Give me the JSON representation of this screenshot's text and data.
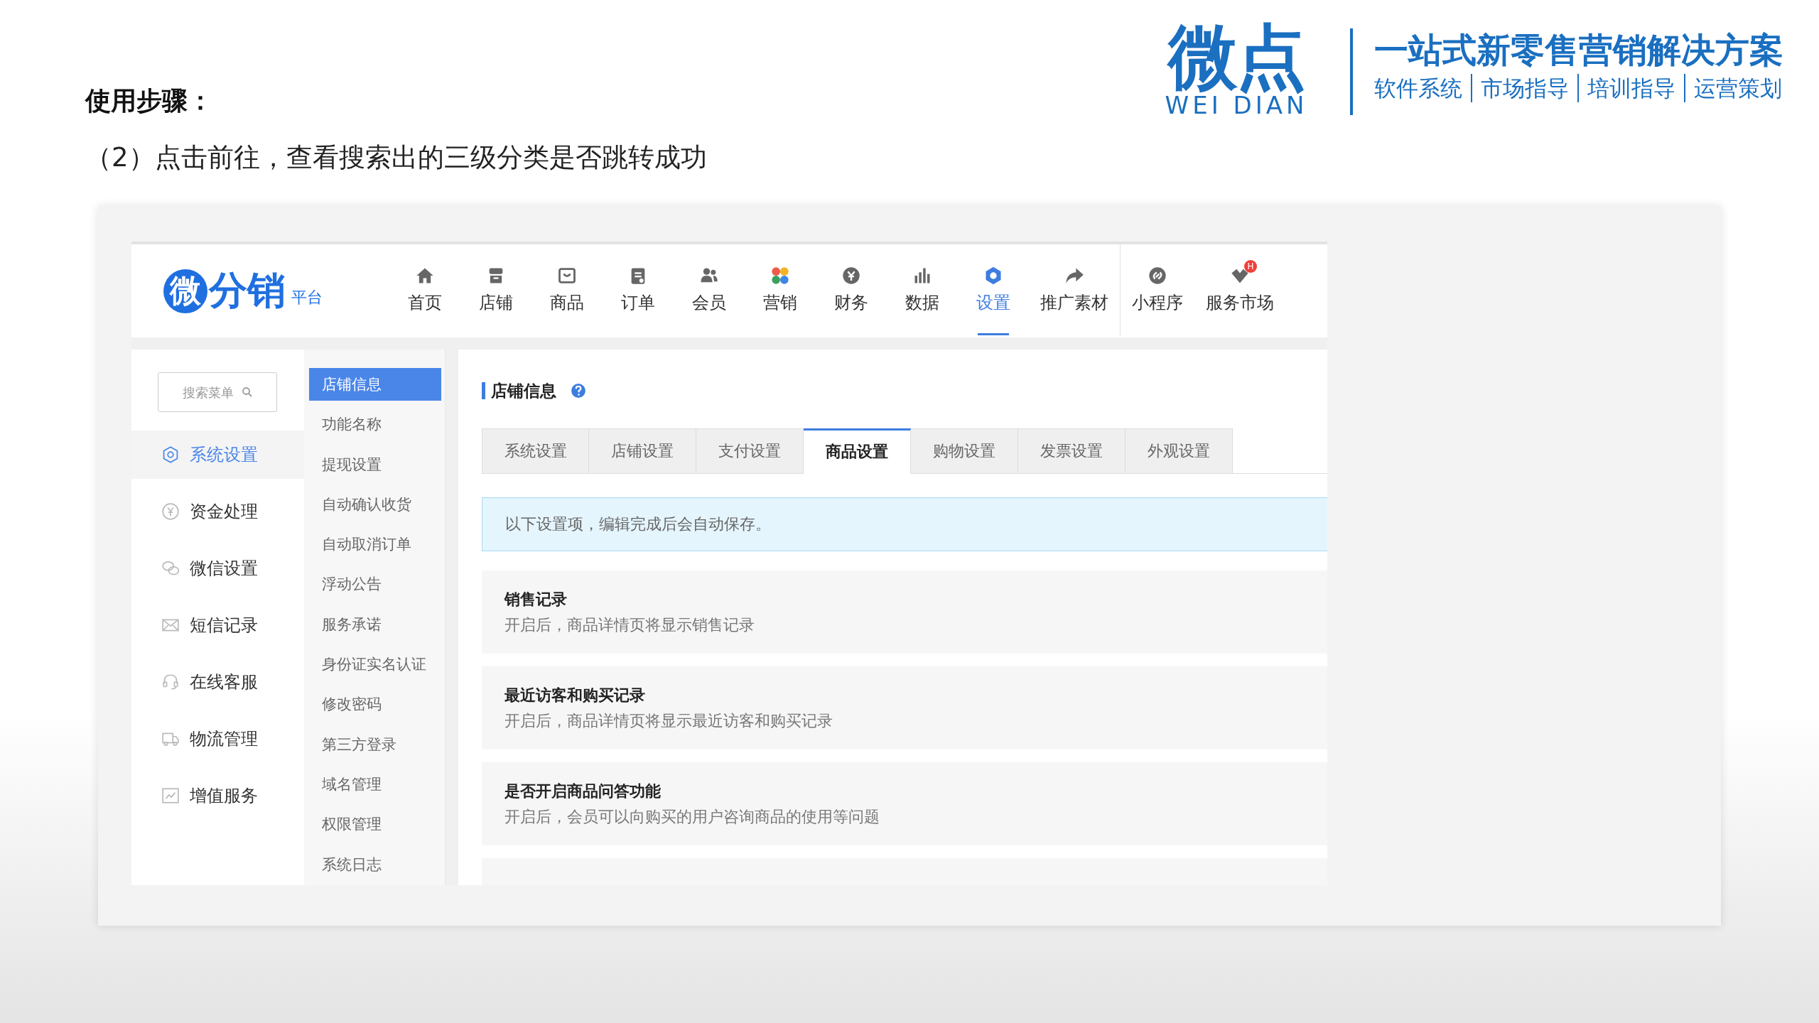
{
  "heading": "使用步骤：",
  "step": "（2）点击前往，查看搜索出的三级分类是否跳转成功",
  "brand": {
    "name": "微点",
    "latin": "WEI DIAN",
    "slogan": "一站式新零售营销解决方案",
    "services": [
      "软件系统",
      "市场指导",
      "培训指导",
      "运营策划"
    ]
  },
  "app": {
    "logo": {
      "mark": "微",
      "name": "分销",
      "suffix": "平台"
    },
    "nav": [
      {
        "label": "首页",
        "kind": "home",
        "selected": false,
        "separated": false
      },
      {
        "label": "店铺",
        "kind": "shop",
        "selected": false,
        "separated": false
      },
      {
        "label": "商品",
        "kind": "goods",
        "selected": false,
        "separated": false
      },
      {
        "label": "订单",
        "kind": "order",
        "selected": false,
        "separated": false
      },
      {
        "label": "会员",
        "kind": "member",
        "selected": false,
        "separated": false
      },
      {
        "label": "营销",
        "kind": "marketing",
        "selected": false,
        "separated": false
      },
      {
        "label": "财务",
        "kind": "finance",
        "selected": false,
        "separated": false
      },
      {
        "label": "数据",
        "kind": "data",
        "selected": false,
        "separated": false
      },
      {
        "label": "设置",
        "kind": "settings",
        "selected": true,
        "separated": false
      },
      {
        "label": "推广素材",
        "kind": "share",
        "selected": false,
        "separated": false
      },
      {
        "label": "小程序",
        "kind": "link",
        "selected": false,
        "separated": true
      },
      {
        "label": "服务市场",
        "kind": "market",
        "selected": false,
        "separated": false,
        "badge": "H"
      }
    ],
    "search": {
      "placeholder": "搜索菜单"
    },
    "sidebar": [
      {
        "label": "系统设置",
        "kind": "gear",
        "selected": true
      },
      {
        "label": "资金处理",
        "kind": "yuan",
        "selected": false
      },
      {
        "label": "微信设置",
        "kind": "chat",
        "selected": false
      },
      {
        "label": "短信记录",
        "kind": "mail",
        "selected": false
      },
      {
        "label": "在线客服",
        "kind": "headset",
        "selected": false
      },
      {
        "label": "物流管理",
        "kind": "truck",
        "selected": false
      },
      {
        "label": "增值服务",
        "kind": "chart",
        "selected": false
      }
    ],
    "submenu": [
      {
        "label": "店铺信息",
        "selected": true
      },
      {
        "label": "功能名称",
        "selected": false
      },
      {
        "label": "提现设置",
        "selected": false
      },
      {
        "label": "自动确认收货",
        "selected": false
      },
      {
        "label": "自动取消订单",
        "selected": false
      },
      {
        "label": "浮动公告",
        "selected": false
      },
      {
        "label": "服务承诺",
        "selected": false
      },
      {
        "label": "身份证实名认证",
        "selected": false
      },
      {
        "label": "修改密码",
        "selected": false
      },
      {
        "label": "第三方登录",
        "selected": false
      },
      {
        "label": "域名管理",
        "selected": false
      },
      {
        "label": "权限管理",
        "selected": false
      },
      {
        "label": "系统日志",
        "selected": false
      }
    ],
    "panel": {
      "title": "店铺信息",
      "tabs": [
        {
          "label": "系统设置",
          "selected": false
        },
        {
          "label": "店铺设置",
          "selected": false
        },
        {
          "label": "支付设置",
          "selected": false
        },
        {
          "label": "商品设置",
          "selected": true
        },
        {
          "label": "购物设置",
          "selected": false
        },
        {
          "label": "发票设置",
          "selected": false
        },
        {
          "label": "外观设置",
          "selected": false
        }
      ],
      "notice": "以下设置项，编辑完成后会自动保存。",
      "settings": [
        {
          "title": "销售记录",
          "description": "开启后，商品详情页将显示销售记录"
        },
        {
          "title": "最近访客和购买记录",
          "description": "开启后，商品详情页将显示最近访客和购买记录"
        },
        {
          "title": "是否开启商品问答功能",
          "description": "开启后，会员可以向购买的用户咨询商品的使用等问题"
        }
      ]
    }
  }
}
